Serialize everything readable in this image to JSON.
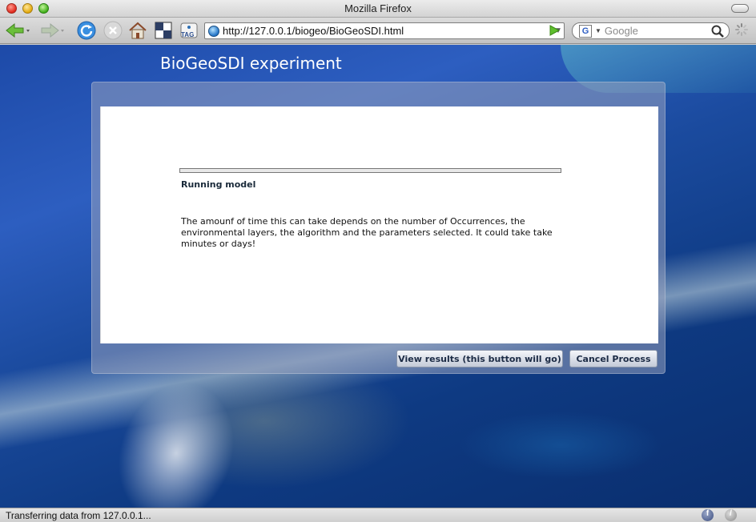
{
  "window": {
    "title": "Mozilla Firefox"
  },
  "toolbar": {
    "url": "http://127.0.0.1/biogeo/BioGeoSDI.html",
    "search_engine_letter": "G",
    "search_placeholder": "Google",
    "tag_label": "TAG",
    "icons": [
      "back-icon",
      "forward-icon",
      "reload-icon",
      "stop-icon",
      "home-icon",
      "bookmark-icon",
      "tag-icon",
      "go-icon",
      "search-icon",
      "throbber-icon"
    ]
  },
  "page": {
    "app_title": "BioGeoSDI experiment",
    "progress_fraction": 0.0,
    "status_label": "Running model",
    "description": "The amounf of time this can take depends on the number of Occurrences, the environmental layers, the algorithm and the parameters selected. It could take take minutes or days!",
    "buttons": {
      "view_results": "View results (this button will go)",
      "cancel": "Cancel Process"
    }
  },
  "statusbar": {
    "text": "Transferring data from 127.0.0.1..."
  },
  "colors": {
    "accent_button_text": "#1c2b45",
    "panel_overlay": "#96a0be",
    "ocean": "#1d4aa8"
  }
}
